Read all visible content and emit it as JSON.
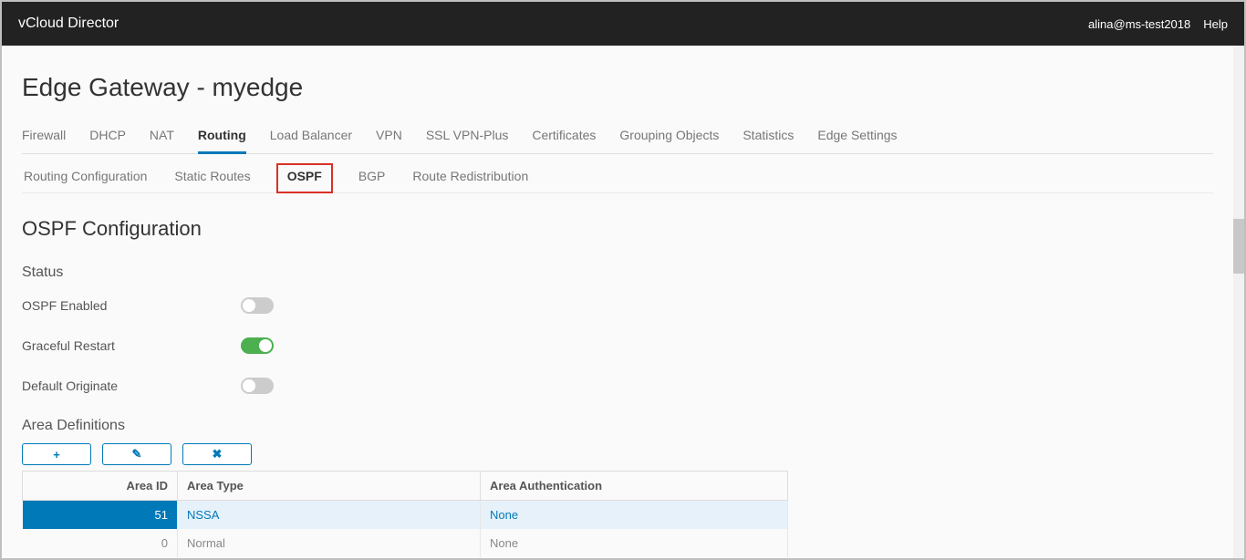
{
  "header": {
    "brand": "vCloud Director",
    "user": "alina@ms-test2018",
    "help": "Help"
  },
  "page": {
    "title": "Edge Gateway - myedge"
  },
  "main_tabs": [
    "Firewall",
    "DHCP",
    "NAT",
    "Routing",
    "Load Balancer",
    "VPN",
    "SSL VPN-Plus",
    "Certificates",
    "Grouping Objects",
    "Statistics",
    "Edge Settings"
  ],
  "main_active": "Routing",
  "sub_tabs": [
    "Routing Configuration",
    "Static Routes",
    "OSPF",
    "BGP",
    "Route Redistribution"
  ],
  "sub_active": "OSPF",
  "section": {
    "title": "OSPF Configuration",
    "status_label": "Status",
    "rows": [
      {
        "label": "OSPF Enabled",
        "on": false
      },
      {
        "label": "Graceful Restart",
        "on": true
      },
      {
        "label": "Default Originate",
        "on": false
      }
    ],
    "area_title": "Area Definitions",
    "icons": {
      "add": "+",
      "edit": "✎",
      "delete": "✖"
    },
    "table": {
      "headers": [
        "Area ID",
        "Area Type",
        "Area Authentication"
      ],
      "rows": [
        {
          "id": "51",
          "type": "NSSA",
          "auth": "None",
          "selected": true
        },
        {
          "id": "0",
          "type": "Normal",
          "auth": "None",
          "selected": false
        }
      ]
    }
  }
}
